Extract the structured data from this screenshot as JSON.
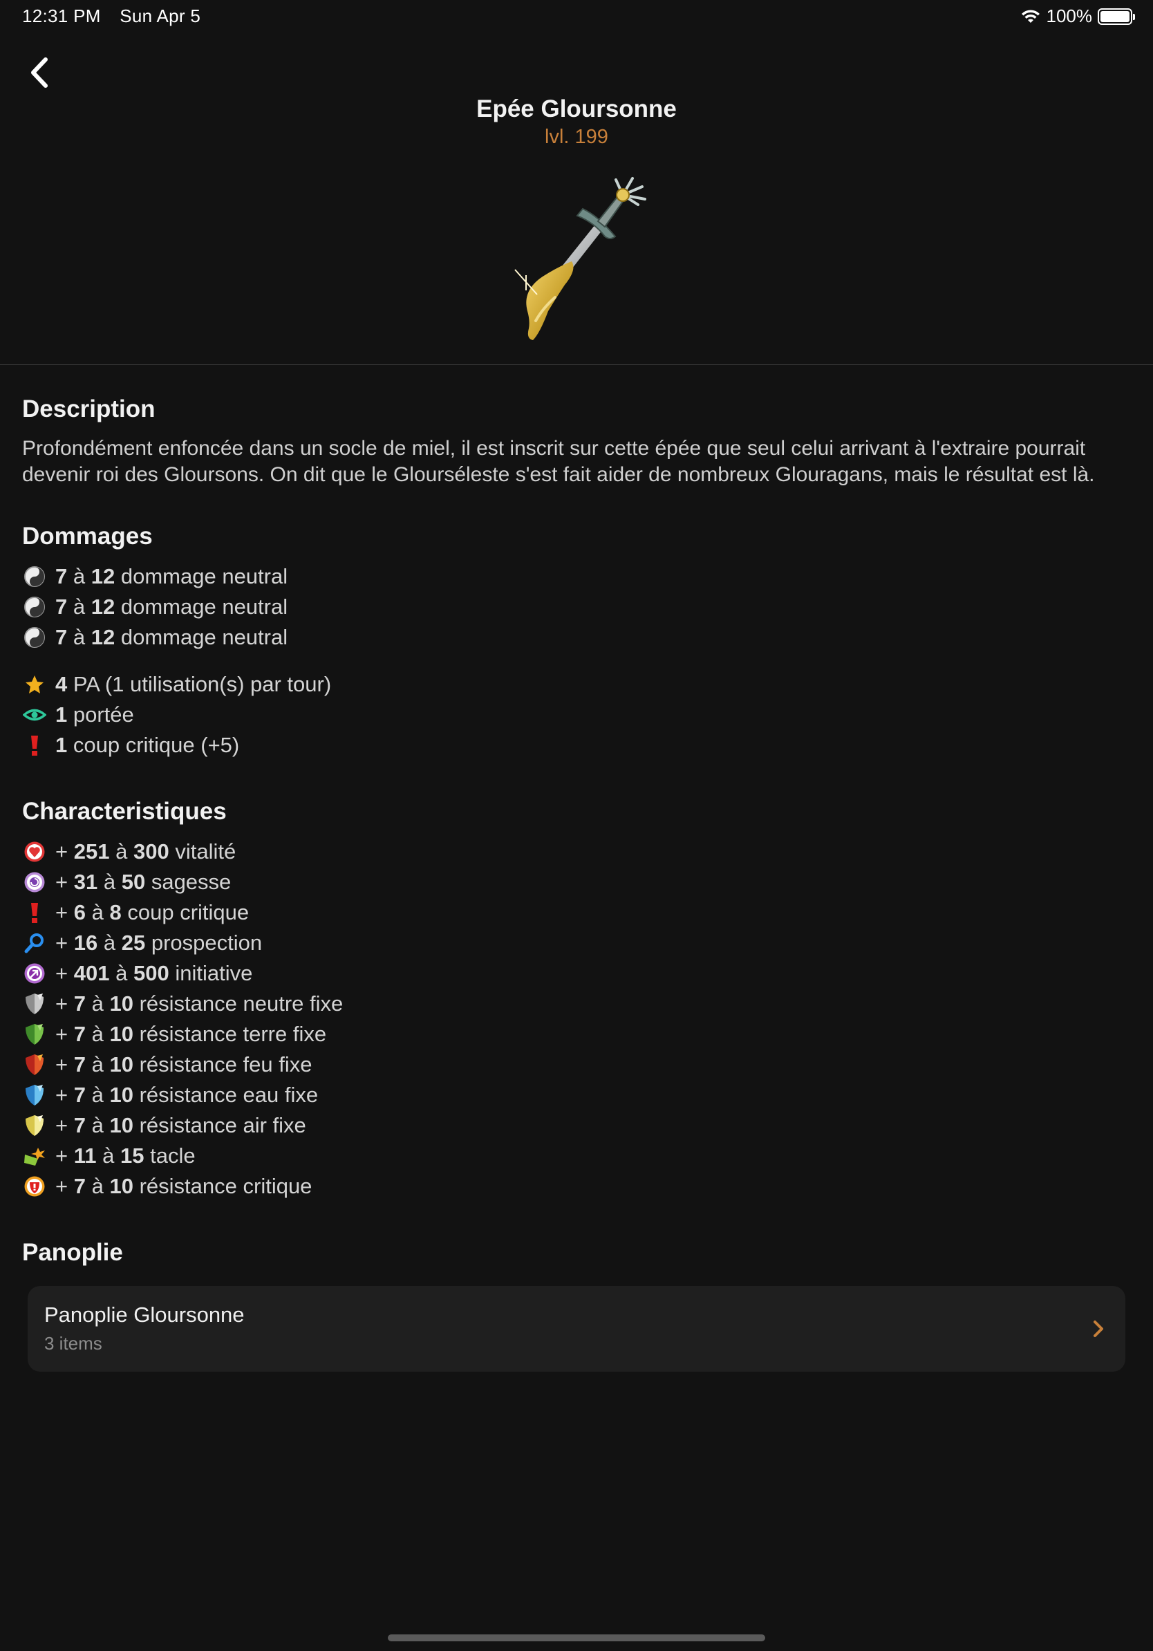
{
  "status_bar": {
    "time": "12:31 PM",
    "date": "Sun Apr 5",
    "battery": "100%",
    "battery_level": 1.0
  },
  "header": {
    "title": "Epée Gloursonne",
    "level": "lvl. 199",
    "back_icon": "chevron-left-icon",
    "image_icon": "sword-icon"
  },
  "description": {
    "title": "Description",
    "text": "Profondément enfoncée dans un socle de miel, il est inscrit sur cette épée que seul celui arrivant à l'extraire pourrait devenir roi des Gloursons. On dit que le Glourséleste s'est fait aider de nombreux Glouragans, mais le résultat est là."
  },
  "dommages": {
    "title": "Dommages",
    "damage_lines": [
      {
        "icon": "neutral-yinyang-icon",
        "min": "7",
        "a": "à",
        "max": "12",
        "label": "dommage neutral"
      },
      {
        "icon": "neutral-yinyang-icon",
        "min": "7",
        "a": "à",
        "max": "12",
        "label": "dommage neutral"
      },
      {
        "icon": "neutral-yinyang-icon",
        "min": "7",
        "a": "à",
        "max": "12",
        "label": "dommage neutral"
      }
    ],
    "extras": [
      {
        "icon": "star-icon",
        "value": "4",
        "label": "PA (1 utilisation(s) par tour)"
      },
      {
        "icon": "eye-icon",
        "value": "1",
        "label": "portée"
      },
      {
        "icon": "exclamation-icon",
        "value": "1",
        "label": "coup critique (+5)"
      }
    ]
  },
  "characteristiques": {
    "title": "Characteristiques",
    "lines": [
      {
        "icon": "heart-icon",
        "prefix": "+",
        "min": "251",
        "a": "à",
        "max": "300",
        "label": "vitalité"
      },
      {
        "icon": "wisdom-icon",
        "prefix": "+",
        "min": "31",
        "a": "à",
        "max": "50",
        "label": "sagesse"
      },
      {
        "icon": "exclamation-icon",
        "prefix": "+",
        "min": "6",
        "a": "à",
        "max": "8",
        "label": "coup critique"
      },
      {
        "icon": "magnifier-icon",
        "prefix": "+",
        "min": "16",
        "a": "à",
        "max": "25",
        "label": "prospection"
      },
      {
        "icon": "initiative-icon",
        "prefix": "+",
        "min": "401",
        "a": "à",
        "max": "500",
        "label": "initiative"
      },
      {
        "icon": "shield-neutral-icon",
        "prefix": "+",
        "min": "7",
        "a": "à",
        "max": "10",
        "label": "résistance neutre fixe"
      },
      {
        "icon": "shield-earth-icon",
        "prefix": "+",
        "min": "7",
        "a": "à",
        "max": "10",
        "label": "résistance terre fixe"
      },
      {
        "icon": "shield-fire-icon",
        "prefix": "+",
        "min": "7",
        "a": "à",
        "max": "10",
        "label": "résistance feu fixe"
      },
      {
        "icon": "shield-water-icon",
        "prefix": "+",
        "min": "7",
        "a": "à",
        "max": "10",
        "label": "résistance eau fixe"
      },
      {
        "icon": "shield-air-icon",
        "prefix": "+",
        "min": "7",
        "a": "à",
        "max": "10",
        "label": "résistance air fixe"
      },
      {
        "icon": "tackle-icon",
        "prefix": "+",
        "min": "11",
        "a": "à",
        "max": "15",
        "label": "tacle"
      },
      {
        "icon": "critical-resistance-icon",
        "prefix": "+",
        "min": "7",
        "a": "à",
        "max": "10",
        "label": "résistance critique"
      }
    ]
  },
  "panoplie": {
    "title": "Panoplie",
    "set_name": "Panoplie Gloursonne",
    "set_count": "3 items",
    "chevron_icon": "chevron-right-icon"
  },
  "colors": {
    "background": "#121212",
    "accent": "#c8803a",
    "card": "#1f1f1f"
  }
}
